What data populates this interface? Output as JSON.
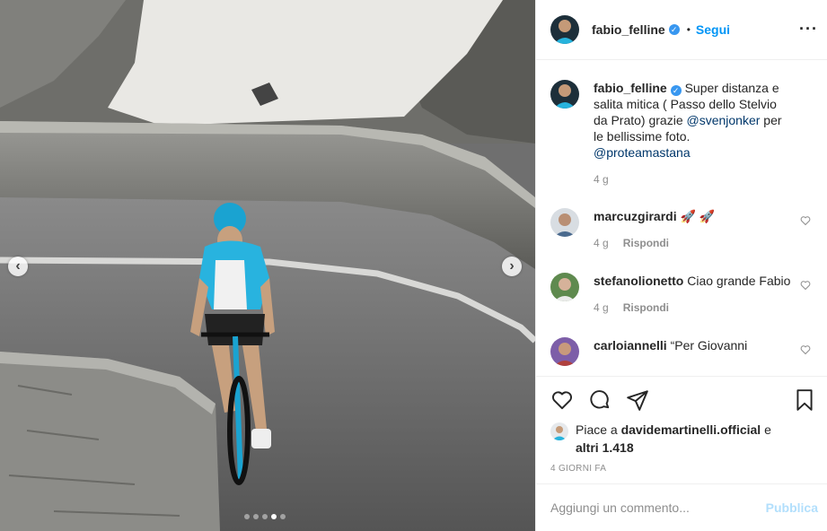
{
  "post": {
    "author": "fabio_felline",
    "follow_label": "Segui",
    "separator": "•",
    "more_icon": "more-horizontal-icon",
    "caption": {
      "author": "fabio_felline",
      "text_before": " Super distanza e salita mitica ( Passo dello Stelvio da Prato) grazie ",
      "mention1": "@svenjonker",
      "text_after": " per le bellissime foto.",
      "mention2": "@proteamastana",
      "time": "4 g"
    },
    "comments": [
      {
        "user": "marcuzgirardi",
        "text": " 🚀 🚀",
        "time": "4 g",
        "reply": "Rispondi"
      },
      {
        "user": "stefanolionetto",
        "text": " Ciao grande Fabio",
        "time": "4 g",
        "reply": "Rispondi"
      },
      {
        "user": "carloiannelli",
        "text": " “Per Giovanni",
        "time": "",
        "reply": ""
      }
    ],
    "likes": {
      "prefix": "Piace a ",
      "user": "davidemartinelli.official",
      "middle": " e",
      "others": "altri 1.418"
    },
    "date": "4 GIORNI FA",
    "comment_placeholder": "Aggiungi un commento...",
    "publish_label": "Pubblica"
  },
  "colors": {
    "accent": "#0095f6",
    "verified": "#3897f0",
    "mention": "#00376b",
    "muted": "#8e8e8e",
    "publish_disabled": "#b2dffc"
  },
  "carousel": {
    "slides": 5,
    "active": 4
  }
}
